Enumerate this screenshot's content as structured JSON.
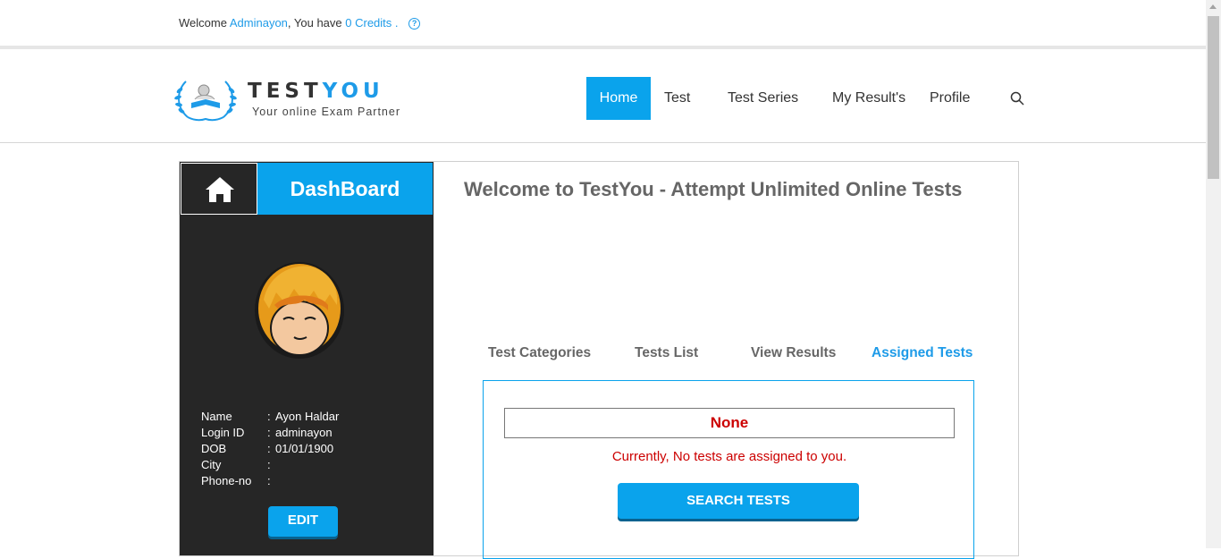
{
  "topbar": {
    "welcome_prefix": "Welcome",
    "username": "Adminayon",
    "separator": ", You have",
    "credits": "0 Credits",
    "dot": "."
  },
  "logo": {
    "title_part1": "TEST",
    "title_part2": "YOU",
    "tagline": "Your online Exam Partner"
  },
  "nav": {
    "items": [
      "Home",
      "Test",
      "Test Series",
      "My Result's",
      "Profile"
    ],
    "active": "Home"
  },
  "sidebar": {
    "heading": "DashBoard",
    "profile": {
      "name_label": "Name",
      "name_value": "Ayon Haldar",
      "login_label": "Login ID",
      "login_value": "adminayon",
      "dob_label": "DOB",
      "dob_value": "01/01/1900",
      "city_label": "City",
      "city_value": "",
      "phone_label": "Phone-no",
      "phone_value": "",
      "colon": ":"
    },
    "edit_label": "EDIT"
  },
  "main": {
    "title": "Welcome to TestYou - Attempt Unlimited Online Tests",
    "tabs": [
      "Test Categories",
      "Tests List",
      "View Results",
      "Assigned Tests"
    ],
    "active_tab": "Assigned Tests",
    "assigned_select_value": "None",
    "empty_message": "Currently, No tests are assigned to you.",
    "search_button": "SEARCH TESTS"
  },
  "colors": {
    "accent": "#0aa3ec",
    "link": "#1e9be8",
    "sidebar_bg": "#262626",
    "error_text": "#cc0000"
  },
  "icons": [
    "help-icon",
    "home-icon",
    "search-icon",
    "avatar-image",
    "laurel-logo"
  ]
}
